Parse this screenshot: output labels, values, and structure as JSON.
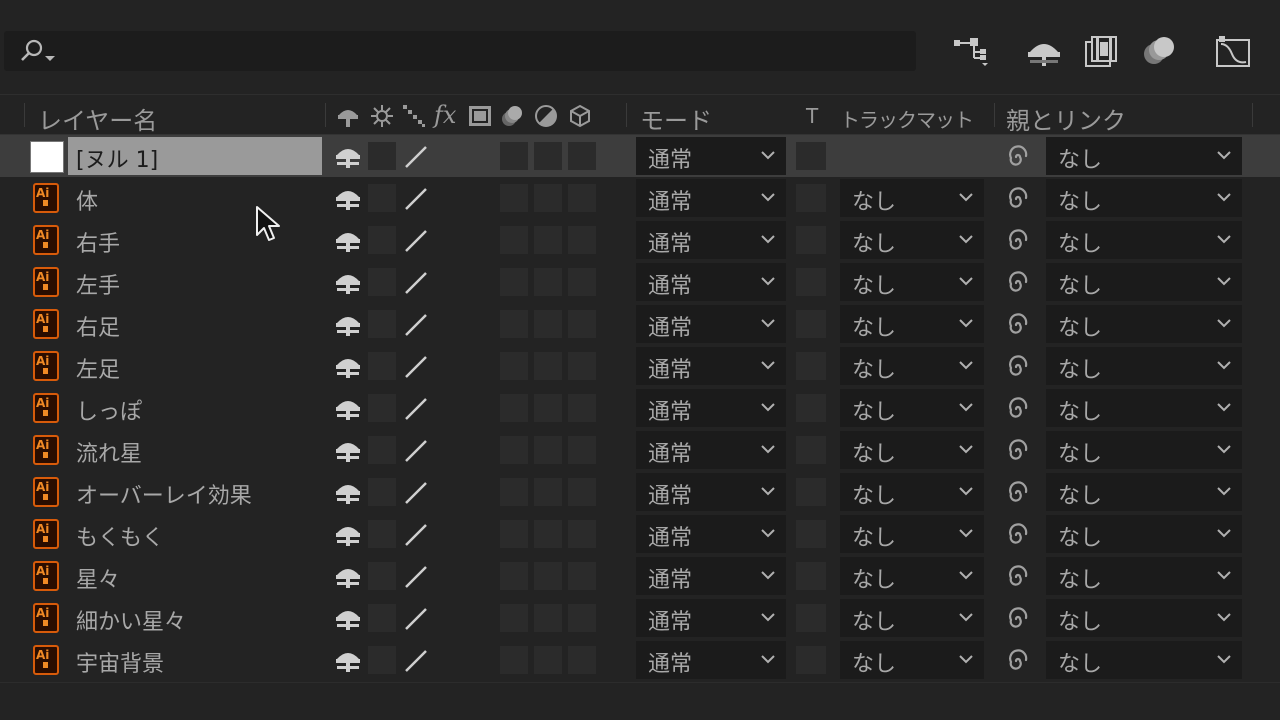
{
  "header": {
    "columns": {
      "layer_name": "レイヤー名",
      "fx": "fx",
      "mode": "モード",
      "t": "T",
      "track_matte": "トラックマット",
      "parent_link": "親とリンク"
    }
  },
  "layers": [
    {
      "name": "[ヌル 1]",
      "type": "null",
      "mode": "通常",
      "track_matte": "",
      "parent": "なし",
      "selected": true
    },
    {
      "name": "体",
      "type": "ai",
      "mode": "通常",
      "track_matte": "なし",
      "parent": "なし"
    },
    {
      "name": "右手",
      "type": "ai",
      "mode": "通常",
      "track_matte": "なし",
      "parent": "なし"
    },
    {
      "name": "左手",
      "type": "ai",
      "mode": "通常",
      "track_matte": "なし",
      "parent": "なし"
    },
    {
      "name": "右足",
      "type": "ai",
      "mode": "通常",
      "track_matte": "なし",
      "parent": "なし"
    },
    {
      "name": "左足",
      "type": "ai",
      "mode": "通常",
      "track_matte": "なし",
      "parent": "なし"
    },
    {
      "name": "しっぽ",
      "type": "ai",
      "mode": "通常",
      "track_matte": "なし",
      "parent": "なし"
    },
    {
      "name": "流れ星",
      "type": "ai",
      "mode": "通常",
      "track_matte": "なし",
      "parent": "なし"
    },
    {
      "name": "オーバーレイ効果",
      "type": "ai",
      "mode": "通常",
      "track_matte": "なし",
      "parent": "なし"
    },
    {
      "name": "もくもく",
      "type": "ai",
      "mode": "通常",
      "track_matte": "なし",
      "parent": "なし"
    },
    {
      "name": "星々",
      "type": "ai",
      "mode": "通常",
      "track_matte": "なし",
      "parent": "なし"
    },
    {
      "name": "細かい星々",
      "type": "ai",
      "mode": "通常",
      "track_matte": "なし",
      "parent": "なし"
    },
    {
      "name": "宇宙背景",
      "type": "ai",
      "mode": "通常",
      "track_matte": "なし",
      "parent": "なし"
    }
  ],
  "icons": {
    "ai_label": "Ai",
    "search": "search-icon",
    "toolbar": [
      "flowchart-icon",
      "shy-icon",
      "frame-blend-icon",
      "motion-blur-icon",
      "graph-editor-icon"
    ]
  },
  "colors": {
    "ai_orange": "#d75b0a",
    "selected_name_bg": "#9a9a9a"
  }
}
